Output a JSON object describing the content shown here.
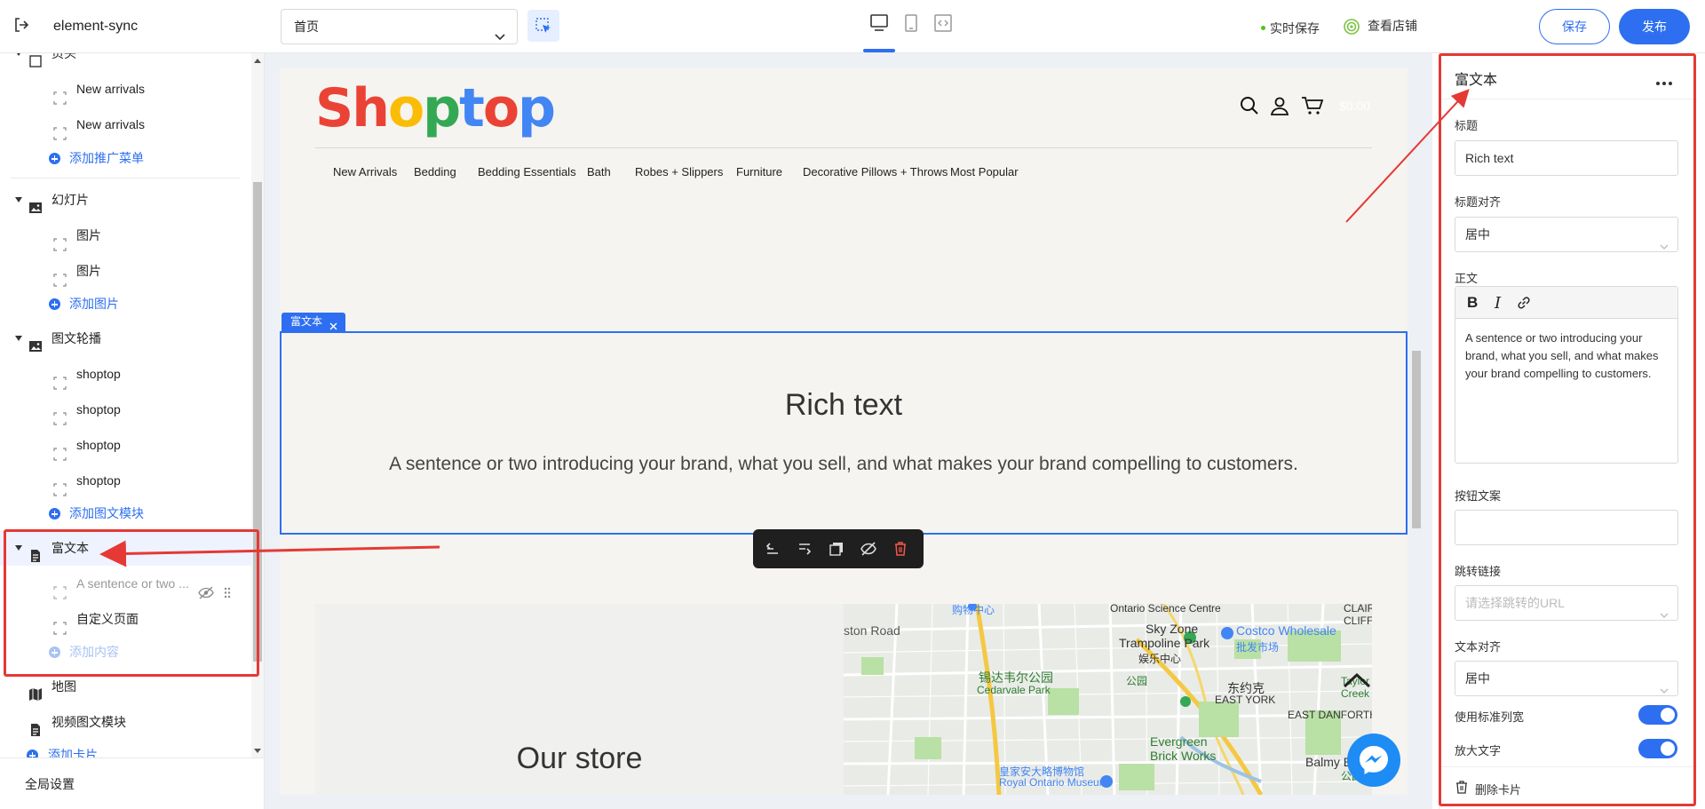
{
  "app": {
    "title": "element-sync"
  },
  "header": {
    "page_select": "首页",
    "autosave": "实时保存",
    "view_store": "查看店铺",
    "save": "保存",
    "publish": "发布"
  },
  "sidebar": {
    "partial_section": "页头",
    "items": [
      {
        "label": "New arrivals"
      },
      {
        "label": "New arrivals"
      }
    ],
    "add_promo_menu": "添加推广菜单",
    "slideshow": {
      "label": "幻灯片",
      "children": [
        "图片",
        "图片"
      ],
      "add": "添加图片"
    },
    "carousel": {
      "label": "图文轮播",
      "children": [
        "shoptop",
        "shoptop",
        "shoptop",
        "shoptop"
      ],
      "add": "添加图文模块"
    },
    "richtext": {
      "label": "富文本",
      "children": [
        "A sentence or two ...",
        "自定义页面"
      ],
      "add": "添加内容"
    },
    "map": "地图",
    "video": "视频图文模块",
    "add_card": "添加卡片",
    "global_settings": "全局设置"
  },
  "store": {
    "logo": [
      "S",
      "h",
      "o",
      "p",
      "t",
      "o",
      "p"
    ],
    "logo_colors": [
      "#ea4335",
      "#ea4335",
      "#fbbc05",
      "#34a853",
      "#4285f4",
      "#ea4335",
      "#4285f4"
    ],
    "cart_total": "$0.00",
    "nav": [
      "New Arrivals",
      "Bedding",
      "Bedding Essentials",
      "Bath",
      "Robes + Slippers",
      "Furniture",
      "Decorative Pillows + Throws",
      "Most Popular"
    ],
    "section_tag": "富文本",
    "richtext_title": "Rich text",
    "richtext_body": "A sentence or two introducing your brand, what you sell, and what makes your brand compelling to customers.",
    "our_store": "Our store",
    "map_labels": [
      "购物中心",
      "ston Road",
      "Ontario Science Centre",
      "CLAIR",
      "CLIFF",
      "Sky Zone",
      "Trampoline Park",
      "娱乐中心",
      "Costco Wholesale",
      "批发市场",
      "锡达韦尔公园",
      "Cedarvale Park",
      "东约克",
      "EAST YORK",
      "Taylor",
      "Creek Pa",
      "EAST DANFORTH",
      "Evergreen",
      "Brick Works",
      "Balmy Bea",
      "皇家安大略博物馆",
      "Royal Ontario Museum",
      "公园",
      "公园"
    ]
  },
  "panel": {
    "title": "富文本",
    "title_label": "标题",
    "title_value": "Rich text",
    "title_align_label": "标题对齐",
    "title_align_value": "居中",
    "body_label": "正文",
    "body_text": "A sentence or two introducing your brand, what you sell, and what makes your brand compelling to customers.",
    "button_label": "按钮文案",
    "button_value": "",
    "link_label": "跳转链接",
    "link_placeholder": "请选择跳转的URL",
    "text_align_label": "文本对齐",
    "text_align_value": "居中",
    "std_width_label": "使用标准列宽",
    "std_width_on": true,
    "enlarge_label": "放大文字",
    "enlarge_on": true,
    "delete": "删除卡片"
  },
  "colors": {
    "accent": "#2d6ff0",
    "annotation": "#e53935",
    "canvas_bg": "#f5f4f0"
  }
}
